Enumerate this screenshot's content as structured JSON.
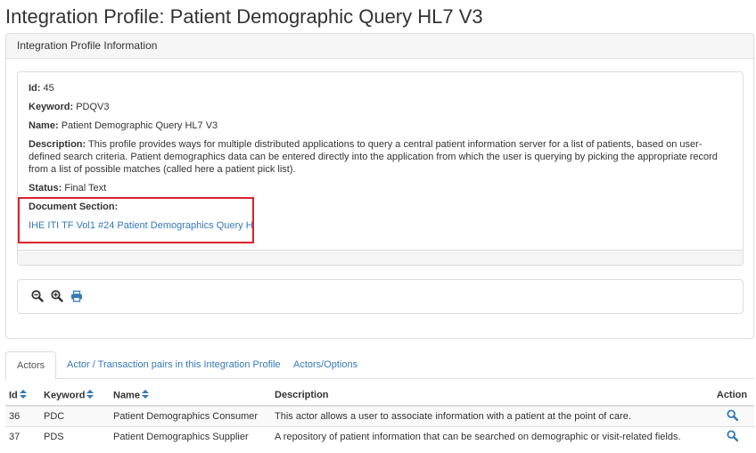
{
  "page": {
    "title": "Integration Profile: Patient Demographic Query HL7 V3"
  },
  "panel": {
    "heading": "Integration Profile Information",
    "fields": {
      "id_label": "Id:",
      "id_value": "45",
      "keyword_label": "Keyword:",
      "keyword_value": "PDQV3",
      "name_label": "Name:",
      "name_value": "Patient Demographic Query HL7 V3",
      "description_label": "Description:",
      "description_value": "This profile provides ways for multiple distributed applications to query a central patient information server for a list of patients, based on user-defined search criteria. Patient demographics data can be entered directly into the application from which the user is querying by picking the appropriate record from a list of possible matches (called here a patient pick list).",
      "status_label": "Status:",
      "status_value": "Final Text",
      "document_section_label": "Document Section:",
      "document_section_link": "IHE ITI TF Vol1 #24 Patient Demographics Query H"
    },
    "toolbar": {
      "icons": [
        "zoom-out-icon",
        "zoom-in-icon",
        "print-icon"
      ]
    }
  },
  "tabs": [
    {
      "label": "Actors",
      "active": true
    },
    {
      "label": "Actor / Transaction pairs in this Integration Profile",
      "active": false
    },
    {
      "label": "Actors/Options",
      "active": false
    }
  ],
  "table": {
    "headers": {
      "id": "Id",
      "keyword": "Keyword",
      "name": "Name",
      "description": "Description",
      "action": "Action"
    },
    "rows": [
      {
        "id": "36",
        "keyword": "PDC",
        "name": "Patient Demographics Consumer",
        "description": "This actor allows a user to associate information with a patient at the point of care."
      },
      {
        "id": "37",
        "keyword": "PDS",
        "name": "Patient Demographics Supplier",
        "description": "A repository of patient information that can be searched on demographic or visit-related fields."
      }
    ]
  },
  "colors": {
    "link": "#337ab7",
    "highlight_border": "#d9232d",
    "border": "#dddddd",
    "panel_heading_bg": "#f5f5f5"
  }
}
